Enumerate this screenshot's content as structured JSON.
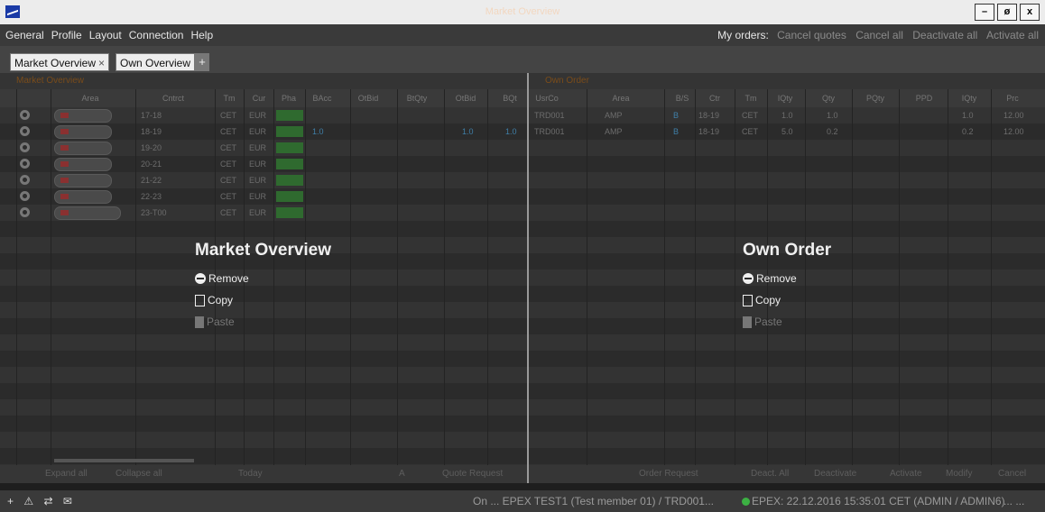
{
  "window": {
    "title": "Market Overview",
    "controls": [
      "–",
      "ø",
      "x"
    ]
  },
  "menu": [
    "General",
    "Profile",
    "Layout",
    "Connection",
    "Help"
  ],
  "my_orders": {
    "label": "My orders:",
    "actions": [
      "Cancel quotes",
      "Cancel all",
      "Deactivate all",
      "Activate all"
    ]
  },
  "tabs": [
    {
      "label": "Market Overview",
      "close": "×"
    },
    {
      "label": "Own Overview"
    }
  ],
  "tab_add": "+",
  "left_panel": {
    "title": "Market Overview",
    "columns": [
      "Area",
      "Cntrct",
      "Tm",
      "Cur",
      "Pha",
      "BAcc",
      "OtBid",
      "BtQty",
      "OtBid",
      "BQt"
    ],
    "rows": [
      {
        "area": "50HZ",
        "contract": "17-18",
        "tz": "CET",
        "cur": "EUR",
        "phase": "CONT"
      },
      {
        "area": "50HZ",
        "contract": "18-19",
        "tz": "CET",
        "cur": "EUR",
        "phase": "CONT",
        "bacc": "1.0",
        "bid": "1.0",
        "bqty": "1.0"
      },
      {
        "area": "50HZ",
        "contract": "19-20",
        "tz": "CET",
        "cur": "EUR",
        "phase": "CONT"
      },
      {
        "area": "50HZ",
        "contract": "20-21",
        "tz": "CET",
        "cur": "EUR",
        "phase": "CONT"
      },
      {
        "area": "50HZ",
        "contract": "21-22",
        "tz": "CET",
        "cur": "EUR",
        "phase": "CONT"
      },
      {
        "area": "50HZ",
        "contract": "22-23",
        "tz": "CET",
        "cur": "EUR",
        "phase": "CONT"
      },
      {
        "area": "50HZ",
        "contract": "23-T00",
        "tz": "CET",
        "cur": "EUR",
        "phase": "CONT"
      }
    ],
    "footer": [
      "Expand all",
      "Collapse all",
      "Today",
      "A",
      "Quote Request"
    ],
    "context_menu": {
      "title": "Market Overview",
      "items": [
        "Remove",
        "Copy",
        "Paste"
      ]
    }
  },
  "right_panel": {
    "title": "Own Order",
    "columns": [
      "UsrCo",
      "Area",
      "B/S",
      "Ctr",
      "Tm",
      "IQty",
      "Qty",
      "PQty",
      "PPD",
      "IQty",
      "Prc"
    ],
    "rows": [
      {
        "user": "TRD001",
        "area": "AMP",
        "bs": "B",
        "ctr": "18-19",
        "tz": "CET",
        "iqty": "1.0",
        "qty": "1.0",
        "iqty2": "1.0",
        "price": "12.00"
      },
      {
        "user": "TRD001",
        "area": "AMP",
        "bs": "B",
        "ctr": "18-19",
        "tz": "CET",
        "iqty": "5.0",
        "qty": "0.2",
        "iqty2": "0.2",
        "price": "12.00"
      }
    ],
    "footer": [
      "Order Request",
      "Deact. All",
      "Deactivate",
      "Activate",
      "Modify",
      "Cancel"
    ],
    "context_menu": {
      "title": "Own Order",
      "items": [
        "Remove",
        "Copy",
        "Paste"
      ]
    }
  },
  "statusbar": {
    "icons": [
      "+",
      "⚠",
      "⇄",
      "✉"
    ],
    "session": "On ...  EPEX TEST1 (Test member 01) / TRD001...",
    "connection": "EPEX: 22.12.2016 15:35:01 CET (ADMIN / ADMIN6)",
    "ellipsis": "...  ..."
  }
}
